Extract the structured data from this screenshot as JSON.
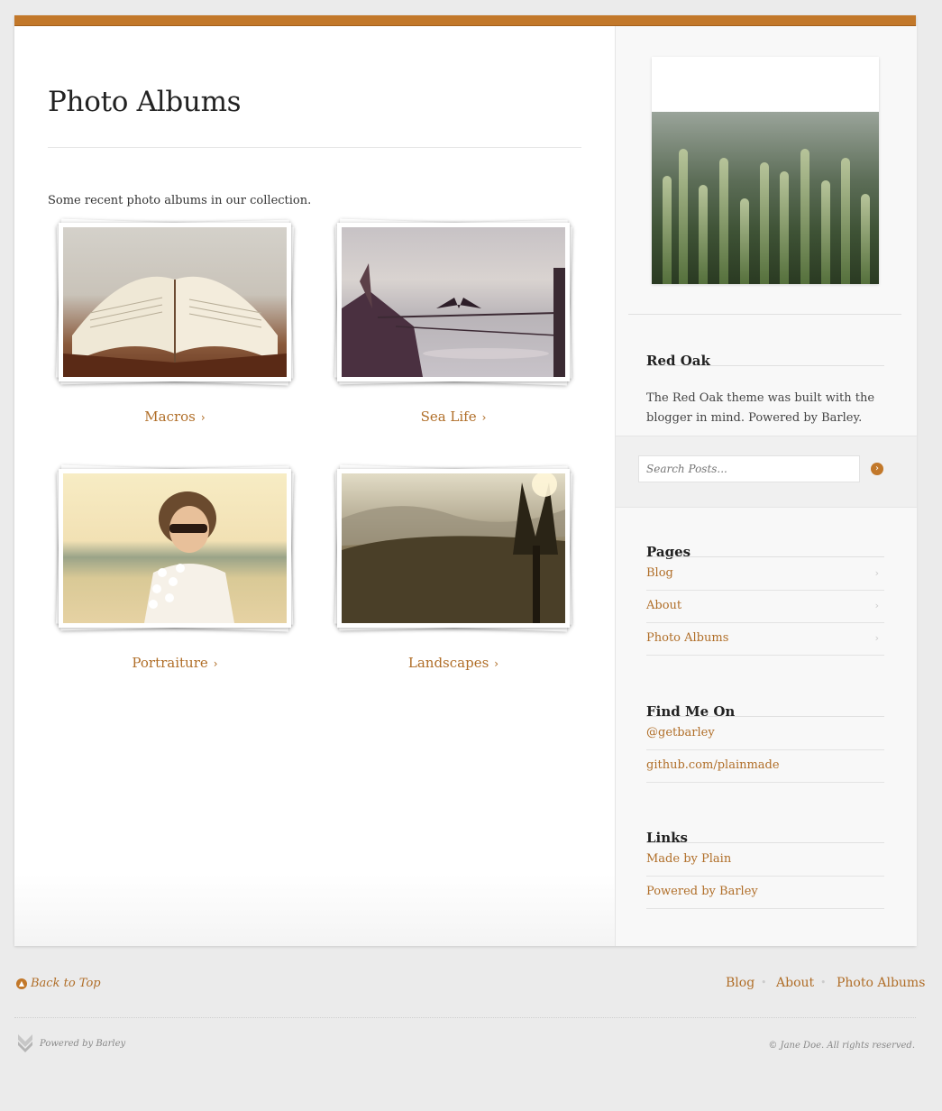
{
  "main": {
    "title": "Photo Albums",
    "intro": "Some recent photo albums in our collection.",
    "albums": [
      {
        "label": "Macros",
        "chevron": "›"
      },
      {
        "label": "Sea Life",
        "chevron": "›"
      },
      {
        "label": "Portraiture",
        "chevron": "›"
      },
      {
        "label": "Landscapes",
        "chevron": "›"
      }
    ]
  },
  "sidebar": {
    "about": {
      "heading": "Red Oak",
      "text": "The Red Oak theme was built with the blogger in mind. Powered by Barley."
    },
    "search": {
      "placeholder": "Search Posts..."
    },
    "pages": {
      "heading": "Pages",
      "items": [
        {
          "label": "Blog",
          "chevron": "›"
        },
        {
          "label": "About",
          "chevron": "›"
        },
        {
          "label": "Photo Albums",
          "chevron": "›"
        }
      ]
    },
    "find_me": {
      "heading": "Find Me On",
      "items": [
        {
          "label": "@getbarley"
        },
        {
          "label": "github.com/plainmade"
        }
      ]
    },
    "links": {
      "heading": "Links",
      "items": [
        {
          "label": "Made by Plain"
        },
        {
          "label": "Powered by Barley"
        }
      ]
    }
  },
  "footer": {
    "back_to_top": "Back to Top",
    "nav": [
      "Blog",
      "About",
      "Photo Albums"
    ],
    "separator": "•",
    "powered_by": "Powered by Barley",
    "copyright": "© Jane  Doe. All rights reserved."
  },
  "colors": {
    "accent": "#c2782a",
    "link": "#b06e28",
    "heading": "#222222"
  },
  "icons": {
    "search_button": "arrow-right-circle-icon",
    "back_to_top": "arrow-up-circle-icon",
    "logo": "barley-logo-icon"
  }
}
